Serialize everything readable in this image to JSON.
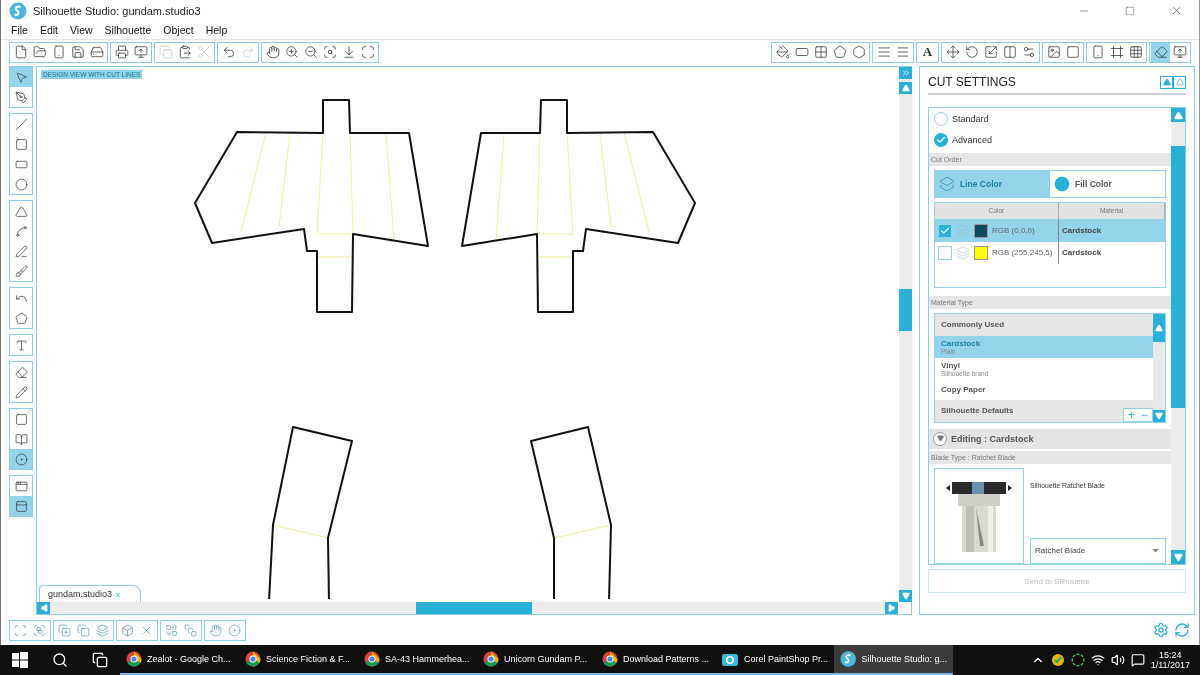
{
  "window": {
    "title": "Silhouette Studio: gundam.studio3"
  },
  "menu": [
    "File",
    "Edit",
    "View",
    "Silhouette",
    "Object",
    "Help"
  ],
  "toolbar_left": [
    [
      {
        "disabled": false
      },
      {
        "disabled": false
      },
      {
        "disabled": false
      },
      {
        "disabled": false
      },
      {
        "disabled": false
      }
    ],
    [
      {
        "disabled": false
      },
      {
        "disabled": false
      }
    ],
    [
      {
        "disabled": true
      },
      {
        "disabled": false
      },
      {
        "disabled": true
      }
    ],
    [
      {
        "disabled": false
      },
      {
        "disabled": true
      }
    ],
    [
      {
        "disabled": false
      },
      {
        "disabled": false
      },
      {
        "disabled": false
      },
      {
        "disabled": false
      },
      {
        "disabled": false
      },
      {
        "disabled": false
      }
    ]
  ],
  "toolbar_right": [
    [
      {
        "selected": false
      },
      {
        "selected": false
      },
      {
        "selected": false
      },
      {
        "selected": false
      },
      {
        "selected": false
      }
    ],
    [
      {
        "selected": false
      },
      {
        "selected": false
      }
    ],
    [
      {
        "selected": false,
        "glyph": "A"
      }
    ],
    [
      {
        "selected": false
      },
      {
        "selected": false
      },
      {
        "selected": false
      },
      {
        "selected": false
      },
      {
        "selected": false
      }
    ],
    [
      {
        "selected": false
      },
      {
        "selected": false
      }
    ],
    [
      {
        "selected": false
      },
      {
        "selected": false
      },
      {
        "selected": false
      }
    ],
    [
      {
        "selected": true
      },
      {
        "selected": false
      }
    ]
  ],
  "tools": [
    [
      {
        "selected": true
      },
      {
        "selected": false
      }
    ],
    [
      {
        "selected": false
      },
      {
        "selected": false
      },
      {
        "selected": false
      },
      {
        "selected": false
      }
    ],
    [
      {
        "selected": false
      },
      {
        "selected": false
      },
      {
        "selected": false
      },
      {
        "selected": false
      }
    ],
    [
      {
        "selected": false
      },
      {
        "selected": false
      }
    ],
    [
      {
        "selected": false
      }
    ],
    [
      {
        "selected": false
      },
      {
        "selected": false
      }
    ],
    [
      {
        "selected": false
      },
      {
        "selected": false
      },
      {
        "selected": true
      }
    ],
    [
      {
        "selected": false
      },
      {
        "selected": true
      }
    ]
  ],
  "canvas": {
    "view_label": "DESIGN VIEW WITH CUT LINES",
    "document_tab": {
      "label": "gundam.studio3",
      "close": "x"
    }
  },
  "cut_settings": {
    "title": "CUT SETTINGS",
    "options": [
      {
        "label": "Standard",
        "selected": false
      },
      {
        "label": "Advanced",
        "selected": true
      }
    ],
    "cut_order": {
      "heading": "Cut Order",
      "modes": [
        {
          "label": "Line Color",
          "selected": true
        },
        {
          "label": "Fill Color",
          "selected": false
        }
      ]
    },
    "color_table": {
      "columns": [
        "Color",
        "Material"
      ],
      "rows": [
        {
          "checked": true,
          "color": "#0f4a5e",
          "label": "RGB (0,0,0)",
          "material": "Cardstock",
          "selected": true
        },
        {
          "checked": false,
          "color": "#ffff00",
          "label": "RGB (255,245,5)",
          "material": "Cardstock",
          "selected": false
        }
      ]
    },
    "material_type": {
      "heading": "Material Type",
      "items": [
        {
          "kind": "header",
          "label": "Commonly Used",
          "selected": false
        },
        {
          "kind": "item",
          "label": "Cardstock",
          "sub": "Plain",
          "selected": true
        },
        {
          "kind": "item",
          "label": "Vinyl",
          "sub": "Silhouette brand",
          "selected": false
        },
        {
          "kind": "item",
          "label": "Copy Paper",
          "selected": false
        },
        {
          "kind": "header",
          "label": "Silhouette Defaults",
          "selected": false
        }
      ],
      "add": "+",
      "remove": "−"
    },
    "editing": {
      "label": "Editing : Cardstock",
      "expanded": true
    },
    "blade": {
      "heading": "Blade Type : Ratchet Blade",
      "name": "Silhouette Ratchet Blade",
      "dropdown": "Ratchet Blade"
    },
    "send_button": {
      "label": "Send to Silhouette",
      "disabled": true
    }
  },
  "taskbar": {
    "apps": [
      {
        "kind": "chrome",
        "label": "Zealot - Google Ch...",
        "active": false
      },
      {
        "kind": "chrome",
        "label": "Science Fiction & F...",
        "active": false
      },
      {
        "kind": "chrome",
        "label": "SA-43 Hammerhea...",
        "active": false
      },
      {
        "kind": "chrome",
        "label": "Unicorn Gundam P...",
        "active": false
      },
      {
        "kind": "chrome",
        "label": "Download Patterns ...",
        "active": false
      },
      {
        "kind": "camera",
        "label": "Corel PaintShop Pr...",
        "active": false
      },
      {
        "kind": "silhouette",
        "label": "Silhouette Studio: g...",
        "active": true
      }
    ],
    "time": "15:24",
    "date": "1/11/2017"
  }
}
